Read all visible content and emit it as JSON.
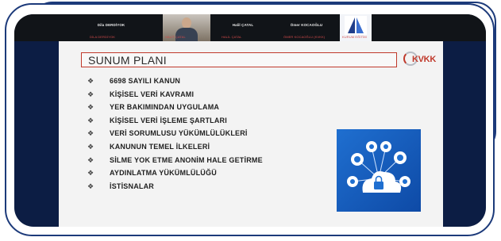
{
  "meeting": {
    "participants": [
      {
        "name": "Dila DERDİYOK",
        "sub": "DİLA DERDİYOK"
      },
      {
        "name": "",
        "sub": "HALİT ÇATAL"
      },
      {
        "name": "Halil ÇATAL",
        "sub": "HALİL ÇATAL"
      },
      {
        "name": "Ömer KOCAOĞLU",
        "sub": "ÖMER KOCAOĞLU (KVKK)"
      },
      {
        "name": "",
        "sub": "KURUM EĞİTİM"
      }
    ]
  },
  "slide": {
    "title": "SUNUM PLANI",
    "logo_text": "KVKK",
    "bullet_glyph": "❖",
    "items": [
      "6698 SAYILI KANUN",
      "KİŞİSEL VERİ KAVRAMI",
      "YER BAKIMINDAN UYGULAMA",
      "KİŞİSEL VERİ İŞLEME ŞARTLARI",
      "VERİ SORUMLUSU YÜKÜMLÜLÜKLERİ",
      "KANUNUN TEMEL İLKELERİ",
      "SİLME YOK ETME ANONİM HALE GETİRME",
      "AYDINLATMA YÜKÜMLÜLÜĞÜ",
      "İSTİSNALAR"
    ],
    "graphic_icon": "cloud-network-icon"
  },
  "colors": {
    "frame": "#1c3a7a",
    "device": "#0c1d44",
    "accent_red": "#c0392b",
    "graphic_blue": "#1f6fd0"
  }
}
